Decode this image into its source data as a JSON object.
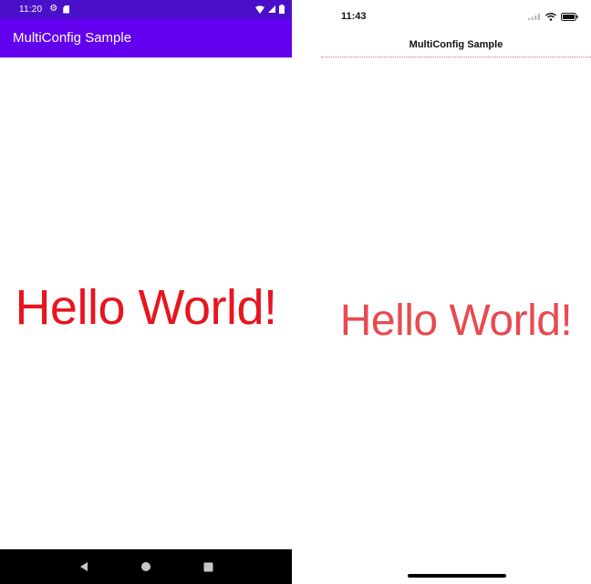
{
  "android": {
    "status_bar": {
      "time": "11:20"
    },
    "toolbar": {
      "title": "MultiConfig Sample"
    },
    "content": {
      "label": "Hello World!"
    },
    "colors": {
      "status_bar": "#4a10c9",
      "toolbar": "#6200ee",
      "label": "#e8141e",
      "nav_bar": "#000000"
    },
    "nav_icons": [
      "back-icon",
      "home-icon",
      "recents-icon"
    ]
  },
  "ios": {
    "status_bar": {
      "time": "11:43"
    },
    "navbar": {
      "title": "MultiConfig Sample"
    },
    "content": {
      "label": "Hello World!"
    },
    "colors": {
      "label": "#e84a50"
    },
    "status_icons": [
      "signal-icon",
      "wifi-icon",
      "battery-icon"
    ]
  }
}
